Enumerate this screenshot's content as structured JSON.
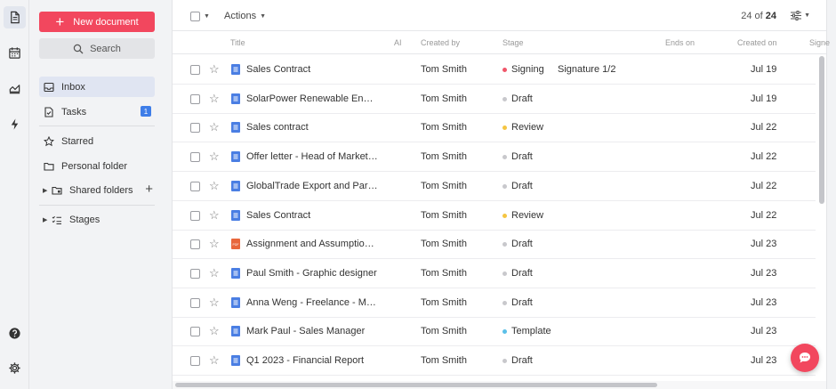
{
  "sidebar": {
    "new_document_label": "New document",
    "search_label": "Search",
    "inbox_label": "Inbox",
    "tasks_label": "Tasks",
    "tasks_count": "1",
    "starred_label": "Starred",
    "personal_folder_label": "Personal folder",
    "shared_folders_label": "Shared folders",
    "stages_label": "Stages"
  },
  "toolbar": {
    "actions_label": "Actions",
    "count_shown": "24 of ",
    "count_total": "24"
  },
  "columns": [
    "Title",
    "AI",
    "Created by",
    "Stage",
    "Ends on",
    "Created on",
    "Signe"
  ],
  "rows": [
    {
      "title": "Sales Contract",
      "file_type": "doc",
      "created_by": "Tom Smith",
      "stage": "Signing",
      "stage_color": "#f0566a",
      "extra": "Signature 1/2",
      "created_on": "Jul 19"
    },
    {
      "title": "SolarPower Renewable Energy ...",
      "file_type": "doc",
      "created_by": "Tom Smith",
      "stage": "Draft",
      "stage_color": "#c8c8cc",
      "extra": "",
      "created_on": "Jul 19"
    },
    {
      "title": "Sales contract",
      "file_type": "doc",
      "created_by": "Tom Smith",
      "stage": "Review",
      "stage_color": "#f5c542",
      "extra": "",
      "created_on": "Jul 22"
    },
    {
      "title": "Offer letter - Head of Marketing",
      "file_type": "doc",
      "created_by": "Tom Smith",
      "stage": "Draft",
      "stage_color": "#c8c8cc",
      "extra": "",
      "created_on": "Jul 22"
    },
    {
      "title": "GlobalTrade Export and Partner...",
      "file_type": "doc",
      "created_by": "Tom Smith",
      "stage": "Draft",
      "stage_color": "#c8c8cc",
      "extra": "",
      "created_on": "Jul 22"
    },
    {
      "title": "Sales Contract",
      "file_type": "doc",
      "created_by": "Tom Smith",
      "stage": "Review",
      "stage_color": "#f5c542",
      "extra": "",
      "created_on": "Jul 22"
    },
    {
      "title": "Assignment and Assumption of...",
      "file_type": "pdf",
      "created_by": "Tom Smith",
      "stage": "Draft",
      "stage_color": "#c8c8cc",
      "extra": "",
      "created_on": "Jul 23"
    },
    {
      "title": "Paul Smith - Graphic designer",
      "file_type": "doc",
      "created_by": "Tom Smith",
      "stage": "Draft",
      "stage_color": "#c8c8cc",
      "extra": "",
      "created_on": "Jul 23"
    },
    {
      "title": "Anna Weng - Freelance - Motion...",
      "file_type": "doc",
      "created_by": "Tom Smith",
      "stage": "Draft",
      "stage_color": "#c8c8cc",
      "extra": "",
      "created_on": "Jul 23"
    },
    {
      "title": "Mark Paul - Sales Manager",
      "file_type": "doc",
      "created_by": "Tom Smith",
      "stage": "Template",
      "stage_color": "#5bc0e8",
      "extra": "",
      "created_on": "Jul 23"
    },
    {
      "title": "Q1 2023 - Financial Report",
      "file_type": "doc",
      "created_by": "Tom Smith",
      "stage": "Draft",
      "stage_color": "#c8c8cc",
      "extra": "",
      "created_on": "Jul 23"
    }
  ],
  "icons": {
    "doc_color": "#4a7ee3",
    "pdf_color": "#e8673c",
    "accent": "#f2475e",
    "badge": "#3e7de8"
  }
}
